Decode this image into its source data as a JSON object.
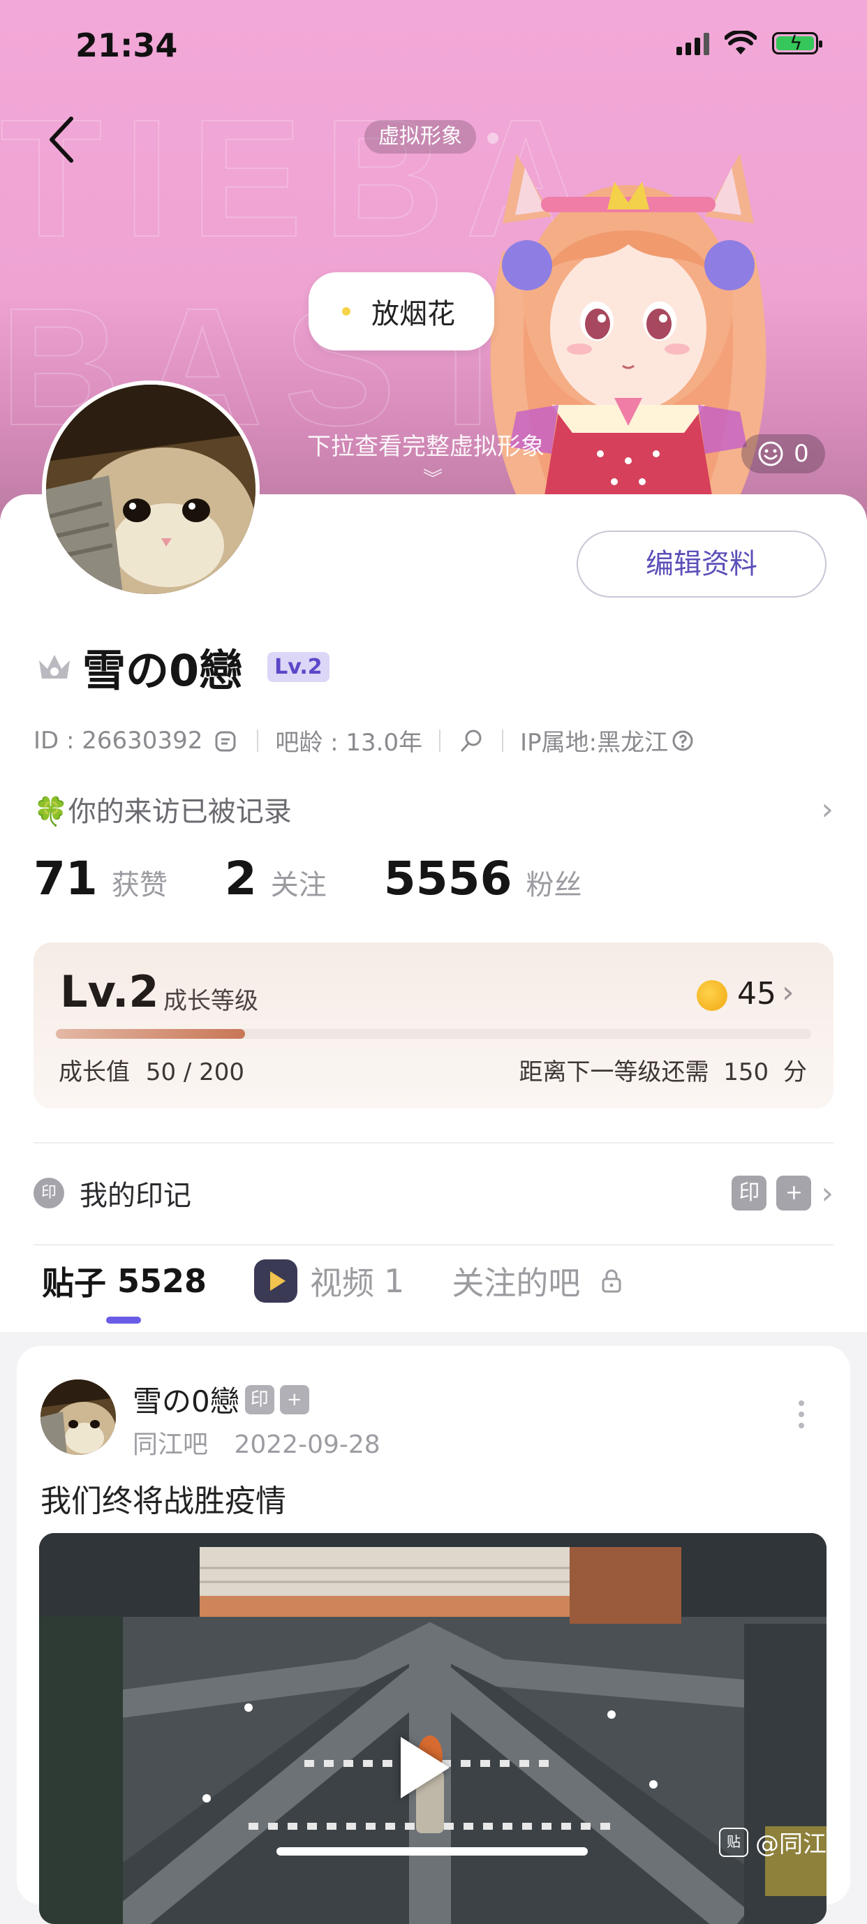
{
  "status_bar": {
    "time": "21:34"
  },
  "header": {
    "virtual_label": "虚拟形象",
    "bubble_text": "放烟花",
    "pull_hint": "下拉查看完整虚拟形象",
    "emoji_count": "0",
    "bg_letters": "TIEBA\nBASTA"
  },
  "profile": {
    "edit_label": "编辑资料",
    "username": "雪の0戀",
    "level_badge": "Lv.2",
    "id_text": "ID : 26630392",
    "age_text": "吧龄 : 13.0年",
    "ip_text": "IP属地:黑龙江",
    "visit_text": "🍀你的来访已被记录"
  },
  "stats": [
    {
      "num": "71",
      "label": "获赞"
    },
    {
      "num": "2",
      "label": "关注"
    },
    {
      "num": "5556",
      "label": "粉丝"
    }
  ],
  "level": {
    "title": "Lv.2",
    "subtitle": "成长等级",
    "coins": "45",
    "progress": 0.25,
    "value_label": "成长值",
    "value_text": "50 / 200",
    "need_label": "距离下一等级还需",
    "need_value": "150",
    "need_unit": "分"
  },
  "marks": {
    "icon": "印",
    "label": "我的印记",
    "badge": "印",
    "add": "+"
  },
  "tabs": {
    "posts_label": "贴子",
    "posts_count": "5528",
    "video_label": "视频",
    "video_count": "1",
    "bars_label": "关注的吧"
  },
  "post": {
    "author": "雪の0戀",
    "badge": "印",
    "add": "+",
    "bar": "同江吧",
    "date": "2022-09-28",
    "text": "我们终将战胜疫情",
    "watermark": "@同江"
  },
  "colors": {
    "accent": "#6b5ce7",
    "header_pink": "#eea3d3"
  }
}
